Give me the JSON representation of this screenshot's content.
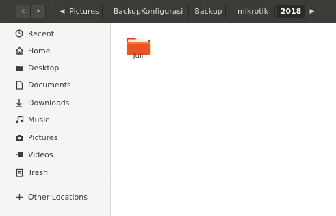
{
  "header": {
    "back_label": "‹",
    "forward_label": "›",
    "breadcrumbs": [
      "Pictures",
      "BackupKonfigurasi",
      "Backup",
      "mikrotik",
      "2018"
    ],
    "active_crumb": "2018"
  },
  "sidebar": {
    "items": [
      {
        "label": "Recent",
        "icon": "clock-icon"
      },
      {
        "label": "Home",
        "icon": "home-icon"
      },
      {
        "label": "Desktop",
        "icon": "folder-icon"
      },
      {
        "label": "Documents",
        "icon": "document-icon"
      },
      {
        "label": "Downloads",
        "icon": "download-icon"
      },
      {
        "label": "Music",
        "icon": "music-icon"
      },
      {
        "label": "Pictures",
        "icon": "camera-icon"
      },
      {
        "label": "Videos",
        "icon": "video-icon"
      },
      {
        "label": "Trash",
        "icon": "trash-icon"
      }
    ],
    "other_locations": {
      "label": "Other Locations",
      "icon": "plus-icon"
    }
  },
  "main": {
    "items": [
      {
        "label": "Juli",
        "type": "folder",
        "color": "#e95420"
      }
    ]
  },
  "colors": {
    "header": "#3c3b37",
    "sidebar": "#f5f5f4",
    "folder": "#e95420"
  }
}
